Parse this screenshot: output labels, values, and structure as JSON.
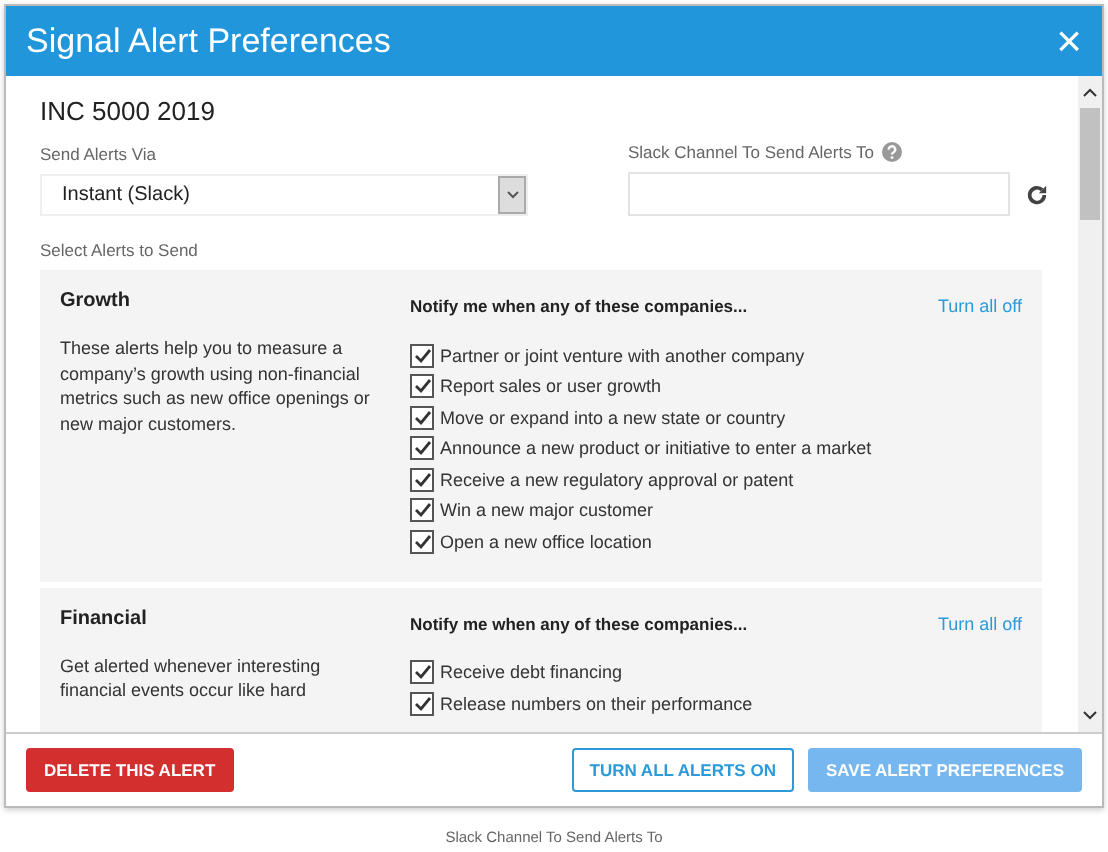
{
  "dialog": {
    "title": "Signal Alert Preferences",
    "close": "×"
  },
  "alert_name": "INC 5000 2019",
  "send_via": {
    "label": "Send Alerts Via",
    "value": "Instant (Slack)"
  },
  "slack_channel": {
    "label": "Slack Channel To Send Alerts To"
  },
  "select_label": "Select Alerts to Send",
  "sections": [
    {
      "title": "Growth",
      "description": "These alerts help you to measure a company’s growth using non-financial metrics such as new office openings or new major customers.",
      "heading": "Notify me when any of these companies...",
      "toggle": "Turn all off",
      "options": [
        {
          "label": "Partner or joint venture with another company",
          "checked": true
        },
        {
          "label": "Report sales or user growth",
          "checked": true
        },
        {
          "label": "Move or expand into a new state or country",
          "checked": true
        },
        {
          "label": "Announce a new product or initiative to enter a market",
          "checked": true
        },
        {
          "label": "Receive a new regulatory approval or patent",
          "checked": true
        },
        {
          "label": "Win a new major customer",
          "checked": true
        },
        {
          "label": "Open a new office location",
          "checked": true
        }
      ]
    },
    {
      "title": "Financial",
      "description": "Get alerted whenever interesting financial events occur like hard",
      "heading": "Notify me when any of these companies...",
      "toggle": "Turn all off",
      "options": [
        {
          "label": "Receive debt financing",
          "checked": true
        },
        {
          "label": "Release numbers on their performance",
          "checked": true
        }
      ]
    }
  ],
  "footer_buttons": [
    {
      "label": "DELETE THIS ALERT",
      "kind": "danger",
      "disabled": false
    },
    {
      "label": "TURN ALL ALERTS ON",
      "kind": "outline",
      "disabled": false
    },
    {
      "label": "SAVE ALERT PREFERENCES",
      "kind": "primary",
      "disabled": true
    }
  ],
  "caption": "Slack Channel To Send Alerts To"
}
